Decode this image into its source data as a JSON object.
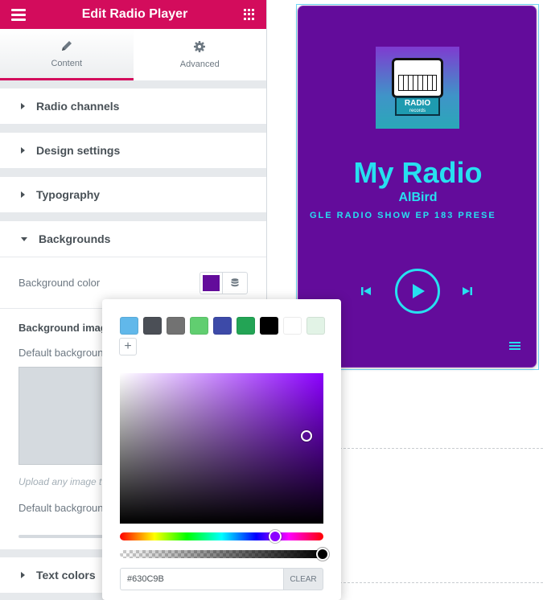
{
  "header": {
    "title": "Edit Radio Player",
    "menu_icon": "hamburger-icon",
    "apps_icon": "grid-icon",
    "color": "#d30c5c"
  },
  "tabs": [
    {
      "label": "Content",
      "icon": "pencil-icon",
      "active": true
    },
    {
      "label": "Advanced",
      "icon": "gear-icon",
      "active": false
    }
  ],
  "sections": {
    "radio_channels": "Radio channels",
    "design_settings": "Design settings",
    "typography": "Typography",
    "backgrounds": "Backgrounds",
    "text_colors": "Text colors"
  },
  "backgrounds": {
    "background_color_label": "Background color",
    "background_color_value": "#630C9B",
    "background_image_title": "Background imag",
    "default_background_label": "Default backgroun",
    "upload_hint": "Upload any image t",
    "default_background_label_2": "Default backgroun"
  },
  "color_picker": {
    "presets": [
      "#61b8ea",
      "#4b4f56",
      "#727272",
      "#61ce70",
      "#3d4aa8",
      "#23a455",
      "#000000",
      "#ffffff",
      "#e2f3e6"
    ],
    "add_label": "+",
    "hex_value": "#630C9B",
    "clear_label": "CLEAR",
    "hue_color": "#8b00ff"
  },
  "player": {
    "background": "#630c9b",
    "accent": "#27e0f0",
    "cover_text": "RADIO",
    "cover_subtext": "records",
    "name": "My Radio",
    "artist": "AlBird",
    "track": "GLE RADIO SHOW EP 183 PRESE"
  }
}
